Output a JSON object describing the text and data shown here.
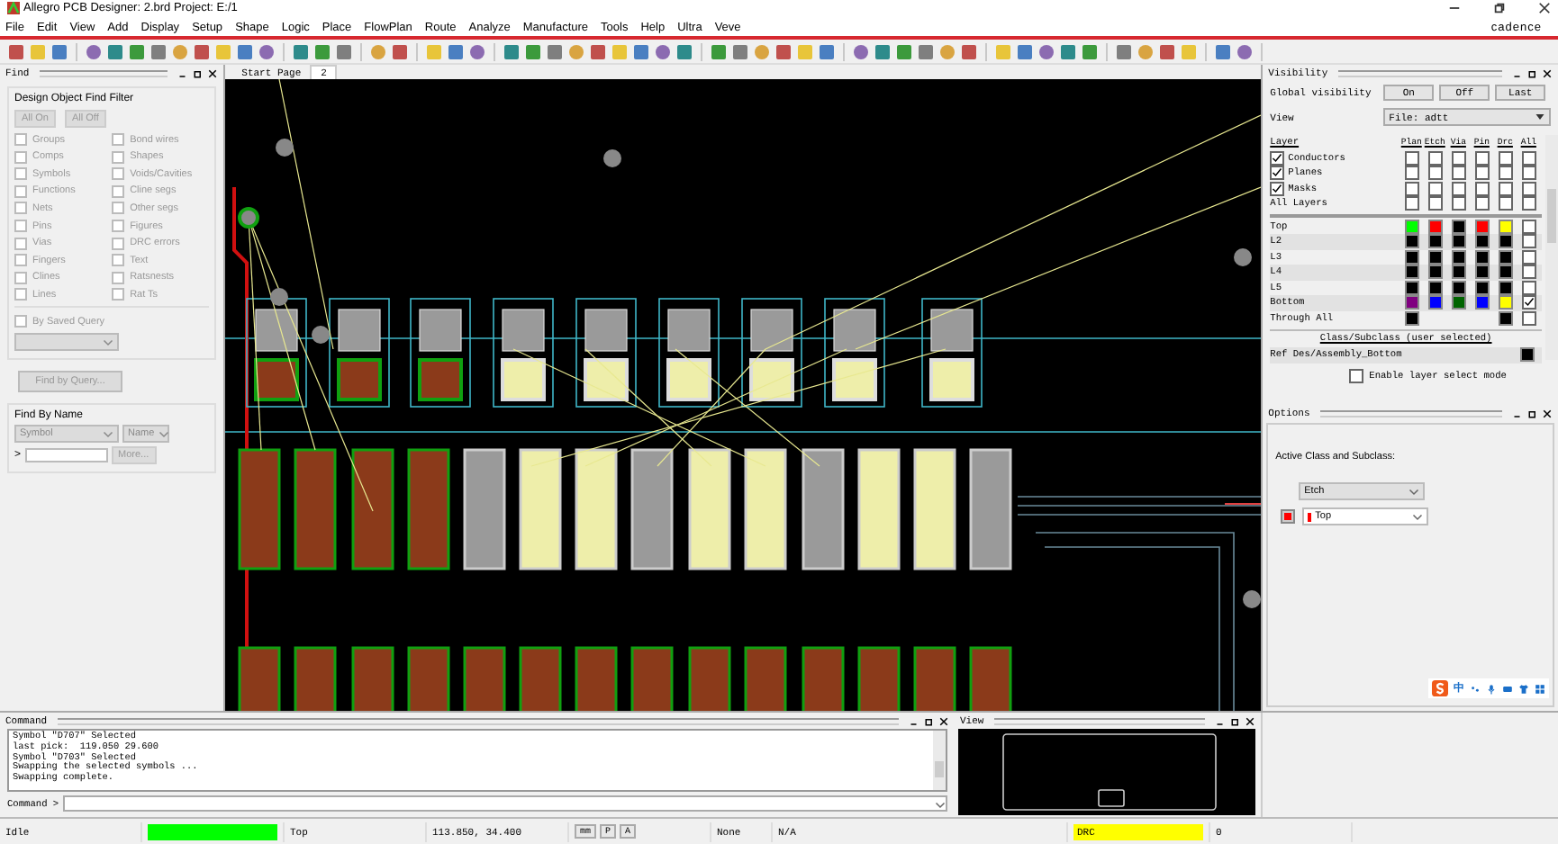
{
  "window": {
    "title": "Allegro PCB Designer: 2.brd  Project: E:/1",
    "brand": "cadence"
  },
  "menu": [
    "File",
    "Edit",
    "View",
    "Add",
    "Display",
    "Setup",
    "Shape",
    "Logic",
    "Place",
    "FlowPlan",
    "Route",
    "Analyze",
    "Manufacture",
    "Tools",
    "Help",
    "Ultra",
    "Veve"
  ],
  "find": {
    "title": "Find",
    "filter_title": "Design Object Find Filter",
    "buttons": [
      {
        "label": "All On",
        "disabled": true
      },
      {
        "label": "All Off",
        "disabled": true
      }
    ],
    "objects": [
      {
        "label": "Groups",
        "checked": false,
        "disabled": true
      },
      {
        "label": "Bond wires",
        "checked": false,
        "disabled": true
      },
      {
        "label": "Comps",
        "checked": false,
        "disabled": true
      },
      {
        "label": "Shapes",
        "checked": false,
        "disabled": true
      },
      {
        "label": "Symbols",
        "checked": false,
        "disabled": true
      },
      {
        "label": "Voids/Cavities",
        "checked": false,
        "disabled": true
      },
      {
        "label": "Functions",
        "checked": false,
        "disabled": true
      },
      {
        "label": "Cline segs",
        "checked": false,
        "disabled": true
      },
      {
        "label": "Nets",
        "checked": false,
        "disabled": true
      },
      {
        "label": "Other segs",
        "checked": false,
        "disabled": true
      },
      {
        "label": "Pins",
        "checked": false,
        "disabled": true
      },
      {
        "label": "Figures",
        "checked": false,
        "disabled": true
      },
      {
        "label": "Vias",
        "checked": false,
        "disabled": true
      },
      {
        "label": "DRC errors",
        "checked": false,
        "disabled": true
      },
      {
        "label": "Fingers",
        "checked": false,
        "disabled": true
      },
      {
        "label": "Text",
        "checked": false,
        "disabled": true
      },
      {
        "label": "Clines",
        "checked": false,
        "disabled": true
      },
      {
        "label": "Ratsnests",
        "checked": false,
        "disabled": true
      },
      {
        "label": "Lines",
        "checked": false,
        "disabled": true
      },
      {
        "label": "Rat Ts",
        "checked": false,
        "disabled": true
      }
    ],
    "saved_query": {
      "label": "By Saved Query",
      "checked": false,
      "disabled": true
    },
    "query_button": {
      "label": "Find by Query...",
      "disabled": true
    },
    "by_name": {
      "title": "Find By Name",
      "type": "Symbol",
      "field": "Name",
      "prompt": ">",
      "more": "More..."
    }
  },
  "tabs": [
    {
      "label": "Start Page",
      "selected": false
    },
    {
      "label": "2",
      "selected": true
    }
  ],
  "visibility": {
    "title": "Visibility",
    "global_label": "Global visibility",
    "buttons": [
      "On",
      "Off",
      "Last"
    ],
    "view_label": "View",
    "view_value": "File: adtt",
    "columns": [
      "Layer",
      "Plan",
      "Etch",
      "Via",
      "Pin",
      "Drc",
      "All"
    ],
    "groups": [
      {
        "label": "Conductors",
        "checked": true,
        "cells": [
          false,
          false,
          false,
          false,
          false,
          false
        ]
      },
      {
        "label": "Planes",
        "checked": true,
        "cells": [
          false,
          false,
          false,
          false,
          false,
          false
        ]
      },
      {
        "label": "Masks",
        "checked": true,
        "cells": [
          false,
          false,
          false,
          false,
          false,
          false
        ]
      },
      {
        "label": "All Layers",
        "cells": [
          false,
          false,
          false,
          false,
          false,
          false
        ]
      }
    ],
    "layers": [
      {
        "label": "Top",
        "swatches": [
          {
            "kind": "swatch",
            "color": "#00ff00"
          },
          {
            "kind": "swatch",
            "color": "#ff0000"
          },
          {
            "kind": "swatch",
            "color": "#000000"
          },
          {
            "kind": "swatch",
            "color": "#ff0000"
          },
          {
            "kind": "swatch",
            "color": "#ffff00"
          }
        ],
        "all": false
      },
      {
        "label": "L2",
        "swatches": [
          {
            "kind": "swatch",
            "color": "#000000"
          },
          {
            "kind": "swatch",
            "color": "#000000"
          },
          {
            "kind": "swatch",
            "color": "#000000"
          },
          {
            "kind": "swatch",
            "color": "#000000"
          },
          {
            "kind": "swatch",
            "color": "#000000"
          }
        ],
        "all": false
      },
      {
        "label": "L3",
        "swatches": [
          {
            "kind": "swatch",
            "color": "#000000"
          },
          {
            "kind": "swatch",
            "color": "#000000"
          },
          {
            "kind": "swatch",
            "color": "#000000"
          },
          {
            "kind": "swatch",
            "color": "#000000"
          },
          {
            "kind": "swatch",
            "color": "#000000"
          }
        ],
        "all": false
      },
      {
        "label": "L4",
        "swatches": [
          {
            "kind": "swatch",
            "color": "#000000"
          },
          {
            "kind": "swatch",
            "color": "#000000"
          },
          {
            "kind": "swatch",
            "color": "#000000"
          },
          {
            "kind": "swatch",
            "color": "#000000"
          },
          {
            "kind": "swatch",
            "color": "#000000"
          }
        ],
        "all": false
      },
      {
        "label": "L5",
        "swatches": [
          {
            "kind": "swatch",
            "color": "#000000"
          },
          {
            "kind": "swatch",
            "color": "#000000"
          },
          {
            "kind": "swatch",
            "color": "#000000"
          },
          {
            "kind": "swatch",
            "color": "#000000"
          },
          {
            "kind": "swatch",
            "color": "#000000"
          }
        ],
        "all": false
      },
      {
        "label": "Bottom",
        "swatches": [
          {
            "kind": "swatch",
            "color": "#800080"
          },
          {
            "kind": "swatch",
            "color": "#0000ff"
          },
          {
            "kind": "swatch",
            "color": "#006400"
          },
          {
            "kind": "swatch",
            "color": "#0000ff"
          },
          {
            "kind": "swatch",
            "color": "#ffff00"
          }
        ],
        "all": true
      },
      {
        "label": "Through All",
        "swatches": [
          {
            "kind": "swatch",
            "color": "#000000"
          },
          {
            "kind": "blank"
          },
          {
            "kind": "blank"
          },
          {
            "kind": "blank"
          },
          {
            "kind": "swatch",
            "color": "#000000"
          }
        ],
        "all": false
      }
    ],
    "class_title": "Class/Subclass (user selected)",
    "class_row": {
      "label": "Ref Des/Assembly_Bottom",
      "color": "#000000"
    },
    "layer_select": {
      "label": "Enable layer select mode",
      "checked": false
    }
  },
  "options": {
    "title": "Options",
    "label": "Active Class and Subclass:",
    "class": "Etch",
    "subclass": {
      "label": "Top",
      "color": "#ff0000"
    }
  },
  "ime": {
    "label": "中"
  },
  "command": {
    "title": "Command",
    "lines": [
      "Symbol \"D707\" Selected",
      "last pick:  119.050 29.600",
      "Symbol \"D703\" Selected",
      "Swapping the selected symbols ...",
      "Swapping complete."
    ],
    "prompt": "Command >"
  },
  "view": {
    "title": "View"
  },
  "status": [
    {
      "kind": "text",
      "text": "Idle"
    },
    {
      "kind": "fill",
      "color": "#00ff00"
    },
    {
      "kind": "text",
      "text": "Top"
    },
    {
      "kind": "text",
      "text": "113.850, 34.400"
    },
    {
      "kind": "keys",
      "keys": [
        "mm",
        "P",
        "A"
      ]
    },
    {
      "kind": "text",
      "text": "None"
    },
    {
      "kind": "text",
      "text": "N/A"
    },
    {
      "kind": "fill-text",
      "text": "DRC",
      "color": "#ffff00"
    },
    {
      "kind": "text",
      "text": "0"
    }
  ]
}
